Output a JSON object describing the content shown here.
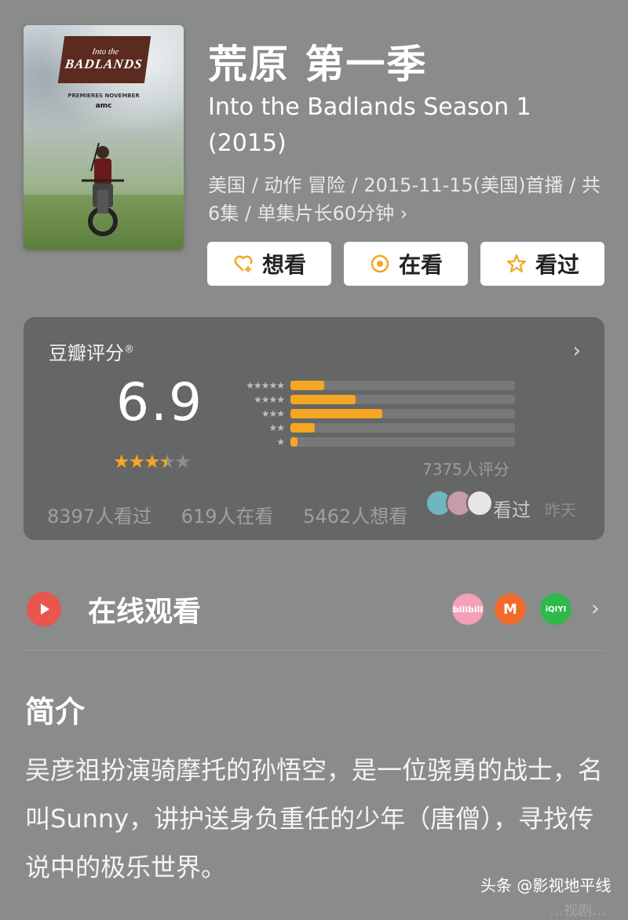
{
  "poster": {
    "logo_line1": "Into the",
    "logo_line2": "BADLANDS",
    "premieres": "PREMIERES NOVEMBER",
    "network": "amc"
  },
  "title": {
    "cn": "荒原 第一季",
    "en": "Into the Badlands Season 1 (2015)"
  },
  "meta": "美国 / 动作 冒险 / 2015-11-15(美国)首播 / 共6集 / 单集片长60分钟 ›",
  "actions": [
    {
      "label": "想看",
      "icon": "heart-plus-icon"
    },
    {
      "label": "在看",
      "icon": "target-icon"
    },
    {
      "label": "看过",
      "icon": "star-outline-icon"
    }
  ],
  "rating": {
    "title": "豆瓣评分",
    "reg": "®",
    "chevron": "›",
    "score": "6.9",
    "stars": 3.5,
    "distribution": [
      {
        "stars": "★★★★★",
        "fraction": 0.15
      },
      {
        "stars": "★★★★",
        "fraction": 0.29
      },
      {
        "stars": "★★★",
        "fraction": 0.41
      },
      {
        "stars": "★★",
        "fraction": 0.11
      },
      {
        "stars": "★",
        "fraction": 0.03
      }
    ],
    "count": "7375人评分",
    "watched": "8397人看过",
    "watching": "619人在看",
    "want": "5462人想看",
    "friends_watched": "看过",
    "friends_time": "昨天"
  },
  "online": {
    "label": "在线观看",
    "platforms": [
      {
        "name": "bilibili",
        "color": "#f3a0b8"
      },
      {
        "name": "M",
        "color": "#f06a2b"
      },
      {
        "name": "iQIYI",
        "color": "#2fb94a"
      }
    ],
    "chevron": "›"
  },
  "intro": {
    "heading": "简介",
    "body": "吴彦祖扮演骑摩托的孙悟空，是一位骁勇的战士，名叫Sunny，讲护送身负重任的少年（唐僧），寻找传说中的极乐世界。"
  },
  "watermark": "头条 @影视地平线",
  "trail": "…视剧…"
}
